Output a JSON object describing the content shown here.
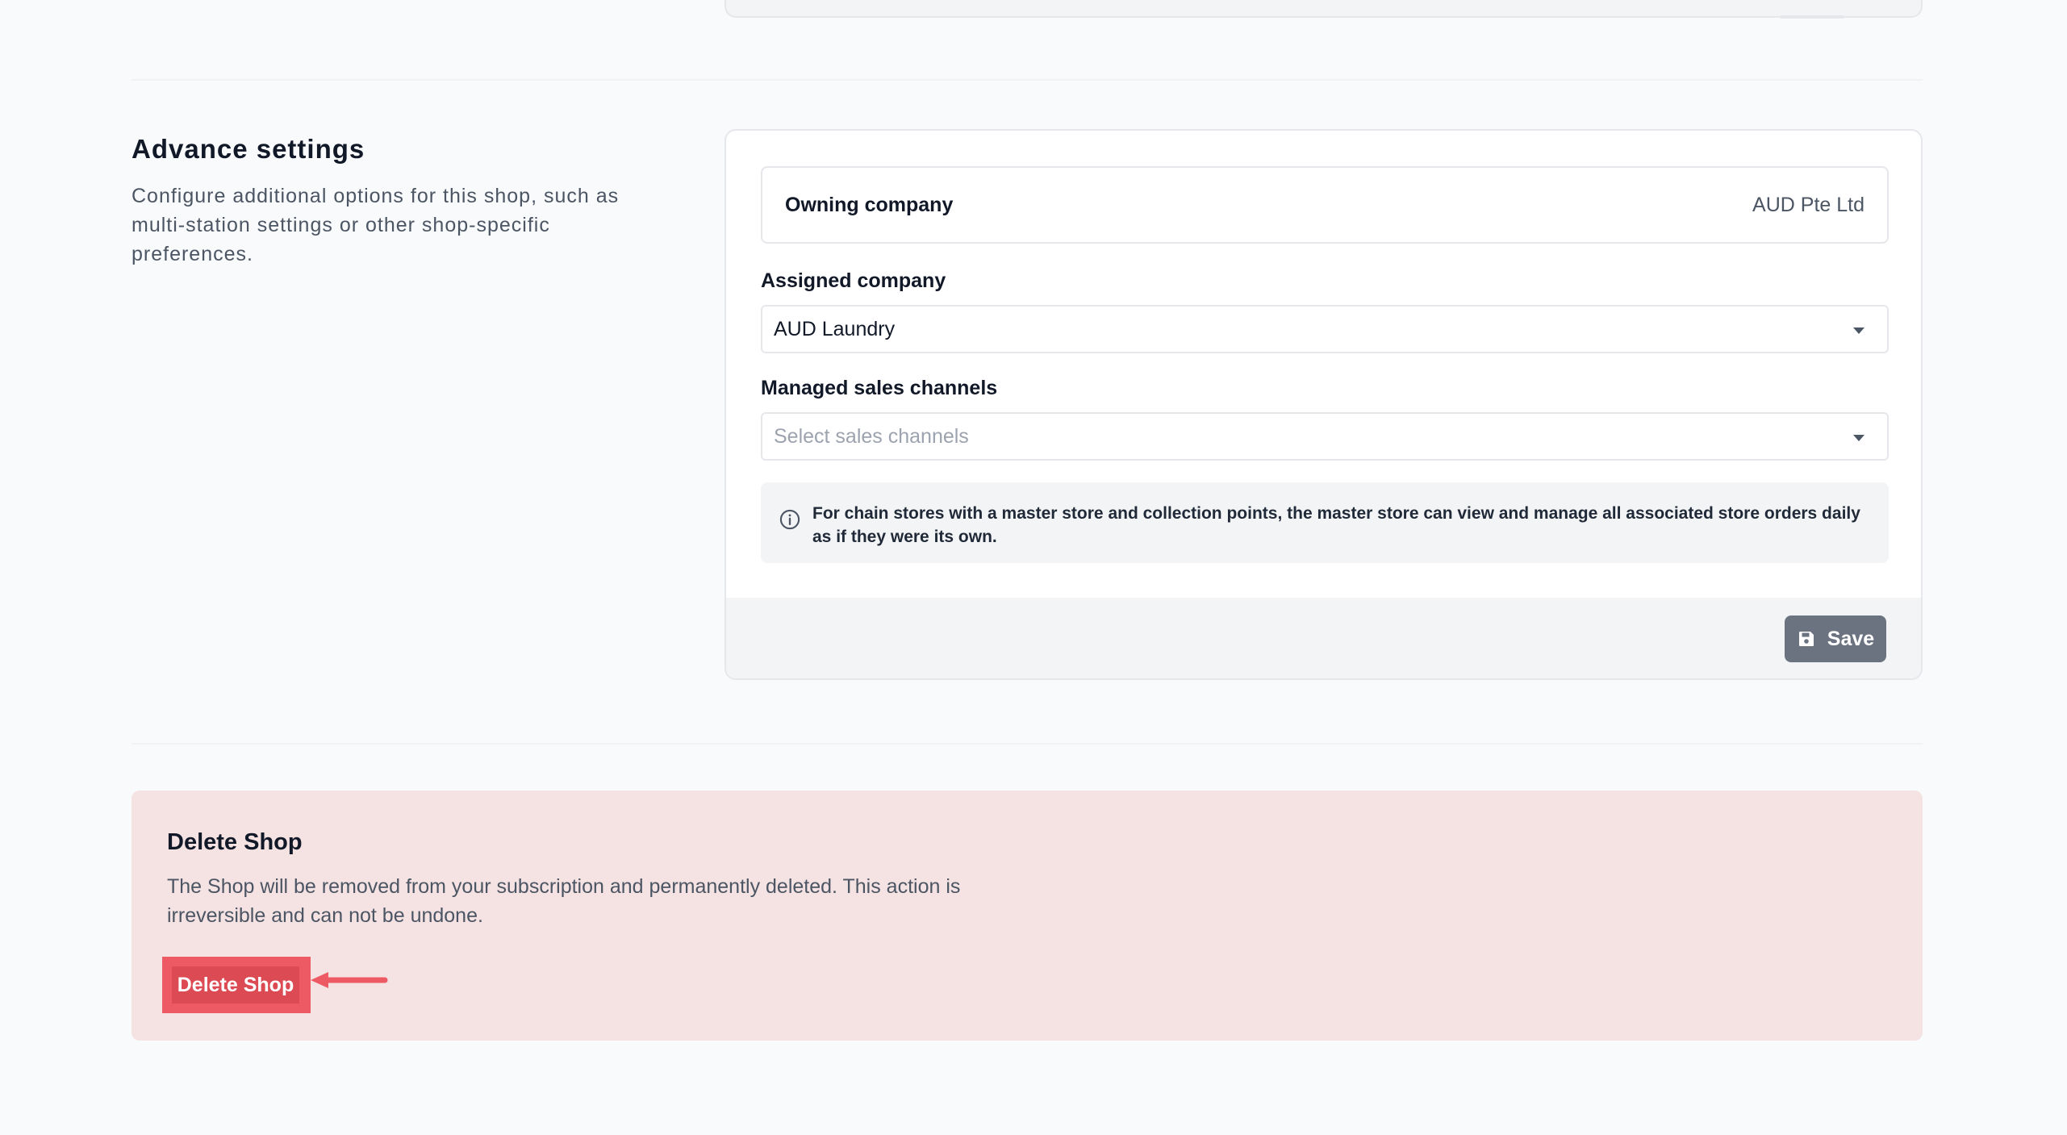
{
  "advance_settings": {
    "title": "Advance settings",
    "description": "Configure additional options for this shop, such as multi-station settings or other shop-specific preferences."
  },
  "settings_card": {
    "owning_company": {
      "label": "Owning company",
      "value": "AUD Pte Ltd"
    },
    "assigned_company": {
      "label": "Assigned company",
      "value": "AUD Laundry"
    },
    "managed_sales_channels": {
      "label": "Managed sales channels",
      "placeholder": "Select sales channels"
    },
    "info": "For chain stores with a master store and collection points, the master store can view and manage all associated store orders daily as if they were its own.",
    "save_label": "Save"
  },
  "delete_shop": {
    "title": "Delete Shop",
    "description": "The Shop will be removed from your subscription and permanently deleted. This action is irreversible and can not be undone.",
    "button_label": "Delete Shop"
  },
  "colors": {
    "save_button": "#6b7280",
    "danger_background": "#f5e3e3",
    "delete_button": "#dc4a54",
    "highlight": "#ee5a63"
  },
  "icons": {
    "save": "floppy-disk-icon",
    "info": "info-circle-icon",
    "dropdown": "caret-down-icon",
    "annotation": "arrow-left-icon"
  }
}
